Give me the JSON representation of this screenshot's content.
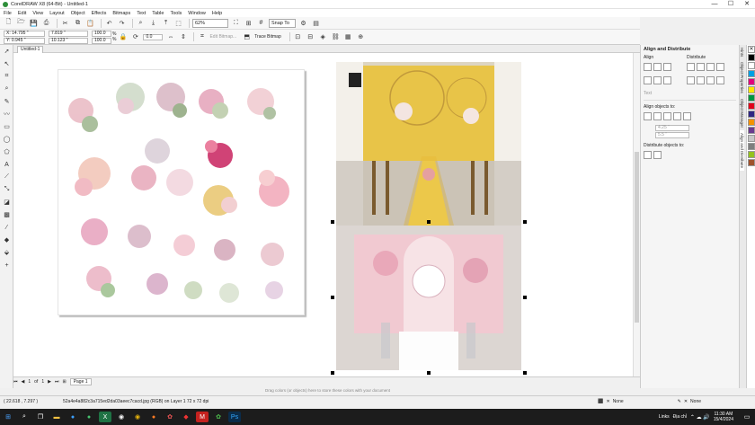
{
  "window": {
    "title": "CorelDRAW X8 (64-Bit) - Untitled-1",
    "min": "—",
    "max": "☐",
    "close": "✕"
  },
  "menu": [
    "File",
    "Edit",
    "View",
    "Layout",
    "Object",
    "Effects",
    "Bitmaps",
    "Text",
    "Table",
    "Tools",
    "Window",
    "Help"
  ],
  "toolbar1": {
    "zoom": "62%",
    "snap": "Snap To"
  },
  "toolbar2": {
    "x": "X: 14.795 \"",
    "y": "Y: 0.945 \"",
    "w": "7.819 \"",
    "h": "10.123 \"",
    "sx": "100.0",
    "sy": "100.0",
    "pct": "%",
    "angle": "0.0",
    "edit_bitmap": "Edit Bitmap...",
    "trace_bitmap": "Trace Bitmap"
  },
  "doc_tab": "Untitled-1",
  "page_nav": {
    "current": "1",
    "of": "of",
    "total": "1",
    "page_label": "Page 1"
  },
  "hint": "Drag colors (or objects) here to store these colors with your document",
  "docker": {
    "title": "Align and Distribute",
    "align": "Align",
    "distribute": "Distribute",
    "text_label": "Text",
    "align_to": "Align objects to:",
    "ax": "4.25 \"",
    "ay": "5.5 \"",
    "distribute_to": "Distribute objects to:"
  },
  "docker_tabs": [
    "Hints",
    "Object Properties",
    "Object Manager",
    "Align and Distribute"
  ],
  "palette": [
    "#000000",
    "#ffffff",
    "#00a0e3",
    "#e3007d",
    "#ffe600",
    "#00963f",
    "#e2001a",
    "#312783",
    "#f39200",
    "#6a3b8e",
    "#c8c8c8",
    "#7f7f7f",
    "#95c11f",
    "#a0522d"
  ],
  "status": {
    "coords": "( 22.618 , 7.297 )",
    "info": "52a4e4a882c3a715ed2da03aeec7cacd.jpg (RGB) on Layer 1 72 x 72 dpi",
    "fill": "None",
    "outline": "None"
  },
  "taskbar": {
    "links": "Links",
    "lang": "Địa chỉ",
    "time": "11:30 AM",
    "date": "15/4/2024"
  }
}
